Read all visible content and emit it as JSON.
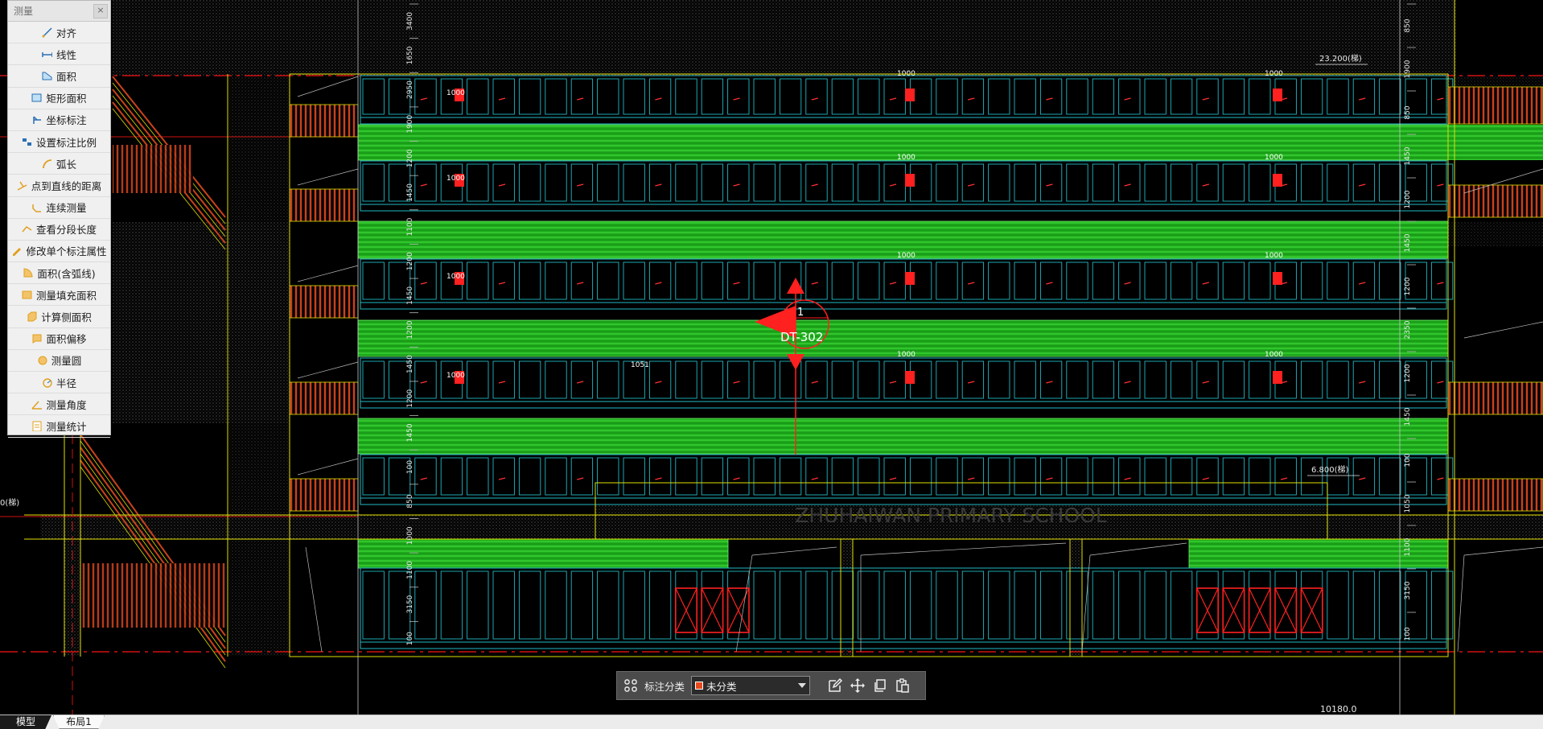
{
  "palette": {
    "title": "测量",
    "close_label": "×",
    "items": [
      {
        "label": "对齐",
        "icon": "align-measure-icon"
      },
      {
        "label": "线性",
        "icon": "linear-measure-icon"
      },
      {
        "label": "面积",
        "icon": "area-icon"
      },
      {
        "label": "矩形面积",
        "icon": "rect-area-icon"
      },
      {
        "label": "坐标标注",
        "icon": "coordinate-icon"
      },
      {
        "label": "设置标注比例",
        "icon": "scale-icon"
      },
      {
        "label": "弧长",
        "icon": "arc-length-icon"
      },
      {
        "label": "点到直线的距离",
        "icon": "point-line-distance-icon"
      },
      {
        "label": "连续测量",
        "icon": "continuous-measure-icon"
      },
      {
        "label": "查看分段长度",
        "icon": "segment-length-icon"
      },
      {
        "label": "修改单个标注属性",
        "icon": "edit-annotation-icon"
      },
      {
        "label": "面积(含弧线)",
        "icon": "arc-area-icon"
      },
      {
        "label": "测量填充面积",
        "icon": "fill-area-icon"
      },
      {
        "label": "计算侧面积",
        "icon": "side-area-icon"
      },
      {
        "label": "面积偏移",
        "icon": "area-offset-icon"
      },
      {
        "label": "测量圆",
        "icon": "circle-measure-icon"
      },
      {
        "label": "半径",
        "icon": "radius-icon"
      },
      {
        "label": "测量角度",
        "icon": "angle-icon"
      },
      {
        "label": "测量统计",
        "icon": "statistics-icon"
      }
    ]
  },
  "drawing": {
    "elevation_top": "23.200(梯)",
    "elevation_mid": "6.800(梯)",
    "elevation_left": "0(梯)",
    "callout_number": "1",
    "callout_code": "DT-302",
    "school_name": "ZHUHAIWAN PRIMARY SCHOOL",
    "tag_1000": "1000",
    "tag_1051": "1051",
    "dims_left": [
      "3400",
      "1650",
      "2950",
      "1900",
      "1200",
      "1450",
      "1100",
      "1200",
      "1450",
      "1200",
      "1450",
      "1200",
      "1450",
      "100",
      "850",
      "1000",
      "1100",
      "3150",
      "100"
    ],
    "dims_right": [
      "850",
      "1900",
      "850",
      "1450",
      "1200",
      "1450",
      "1200",
      "2350",
      "1200",
      "1450",
      "100",
      "1050",
      "1100",
      "3150",
      "100"
    ]
  },
  "toolbar": {
    "grid_icon": "grid-icon",
    "label": "标注分类",
    "select_value": "未分类",
    "select_color": "#e8491d",
    "actions": [
      "edit-icon",
      "move-icon",
      "copy-icon",
      "paste-icon"
    ]
  },
  "tabs": {
    "model": "模型",
    "layout1": "布局1"
  },
  "status": {
    "coords": "10180.0"
  },
  "colors": {
    "background": "#000000",
    "glass": "#1fb8c4",
    "band": "#22c11f",
    "frame": "#e0e000",
    "railing": "#c8421c",
    "window_red": "#ff2020"
  }
}
